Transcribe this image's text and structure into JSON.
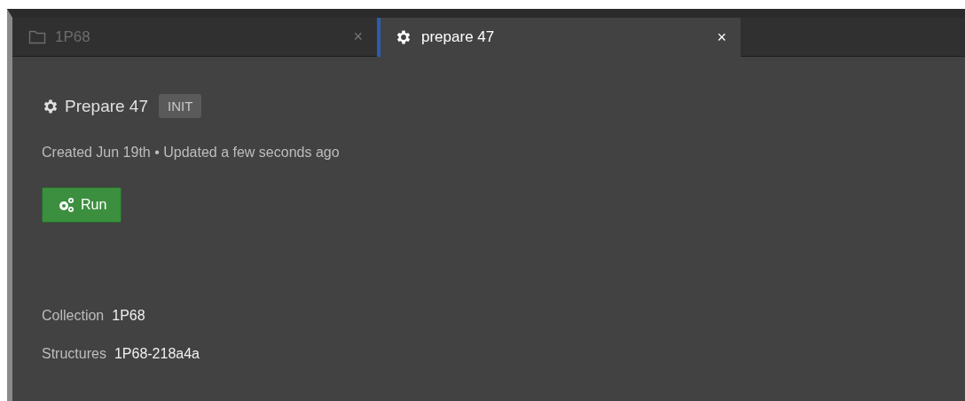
{
  "tabs": [
    {
      "kind": "folder",
      "label": "1P68",
      "close": "×",
      "selected": false
    },
    {
      "kind": "gear",
      "label": "prepare 47",
      "close": "×",
      "selected": true
    }
  ],
  "header": {
    "title": "Prepare 47",
    "status": "INIT"
  },
  "meta": "Created Jun 19th • Updated a few seconds ago",
  "run_button": {
    "label": "Run"
  },
  "properties": [
    {
      "label": "Collection",
      "value": "1P68"
    },
    {
      "label": "Structures",
      "value": "1P68-218a4a"
    }
  ]
}
